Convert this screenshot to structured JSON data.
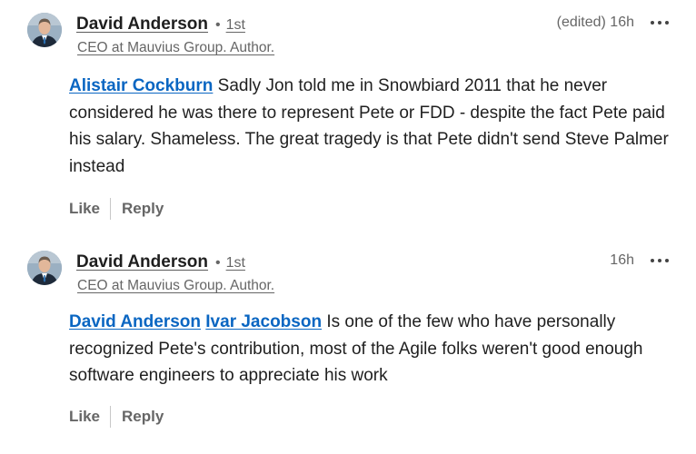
{
  "comments": [
    {
      "author": "David Anderson",
      "degree": "1st",
      "headline": "CEO at Mauvius Group. Author.",
      "timestamp": "(edited) 16h",
      "mentions": [
        "Alistair Cockburn"
      ],
      "text": " Sadly Jon told me in Snowbiard 2011 that he never considered he was there to represent Pete or FDD - despite the fact Pete paid his salary. Shameless. The great tragedy is that Pete didn't send Steve Palmer instead",
      "like_label": "Like",
      "reply_label": "Reply"
    },
    {
      "author": "David Anderson",
      "degree": "1st",
      "headline": "CEO at Mauvius Group. Author.",
      "timestamp": "16h",
      "mentions": [
        "David Anderson",
        "Ivar Jacobson"
      ],
      "text": " Is one of the few who have personally recognized Pete's contribution, most of the Agile folks weren't good enough software engineers to appreciate his work",
      "like_label": "Like",
      "reply_label": "Reply"
    }
  ],
  "colors": {
    "mention": "#0a66c2",
    "secondary_text": "#666666",
    "primary_text": "#1f1f1f"
  },
  "icons": {
    "avatar": "profile-photo",
    "more": "more-options-icon"
  }
}
